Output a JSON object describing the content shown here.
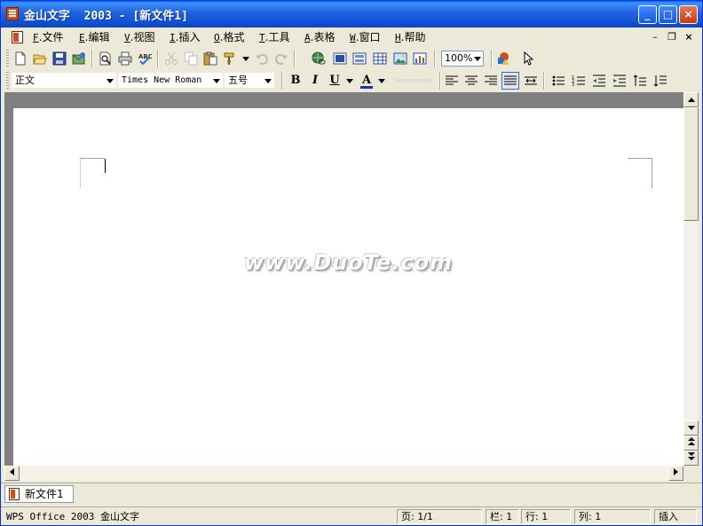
{
  "window": {
    "title": "金山文字  2003 - [新文件1]",
    "controls": {
      "minimize": "_",
      "maximize": "□",
      "close": "×"
    }
  },
  "menubar": {
    "items": [
      {
        "acc": "F",
        "label": "文件"
      },
      {
        "acc": "E",
        "label": "编辑"
      },
      {
        "acc": "V",
        "label": "视图"
      },
      {
        "acc": "I",
        "label": "插入"
      },
      {
        "acc": "O",
        "label": "格式"
      },
      {
        "acc": "T",
        "label": "工具"
      },
      {
        "acc": "A",
        "label": "表格"
      },
      {
        "acc": "W",
        "label": "窗口"
      },
      {
        "acc": "H",
        "label": "帮助"
      }
    ],
    "mdi": {
      "minimize": "–",
      "restore": "❐",
      "close": "×"
    }
  },
  "standard_toolbar": {
    "zoom": "100%"
  },
  "format_toolbar": {
    "style": "正文",
    "font": "Times New Roman",
    "size": "五号",
    "bold": "B",
    "italic": "I",
    "underline": "U",
    "font_color_letter": "A",
    "font_color": "#1F2FB8"
  },
  "document": {
    "watermark": "www.DuoTe.com"
  },
  "doc_tabs": [
    {
      "label": "新文件1"
    }
  ],
  "statusbar": {
    "app": "WPS Office 2003 金山文字",
    "page": "页: 1/1",
    "column": "栏: 1",
    "line": "行: 1",
    "col": "列: 1",
    "mode": "插入"
  },
  "colors": {
    "titlebar": "#0A5FE8",
    "chrome": "#ECE9D8",
    "app_icon": "#D84A12"
  }
}
